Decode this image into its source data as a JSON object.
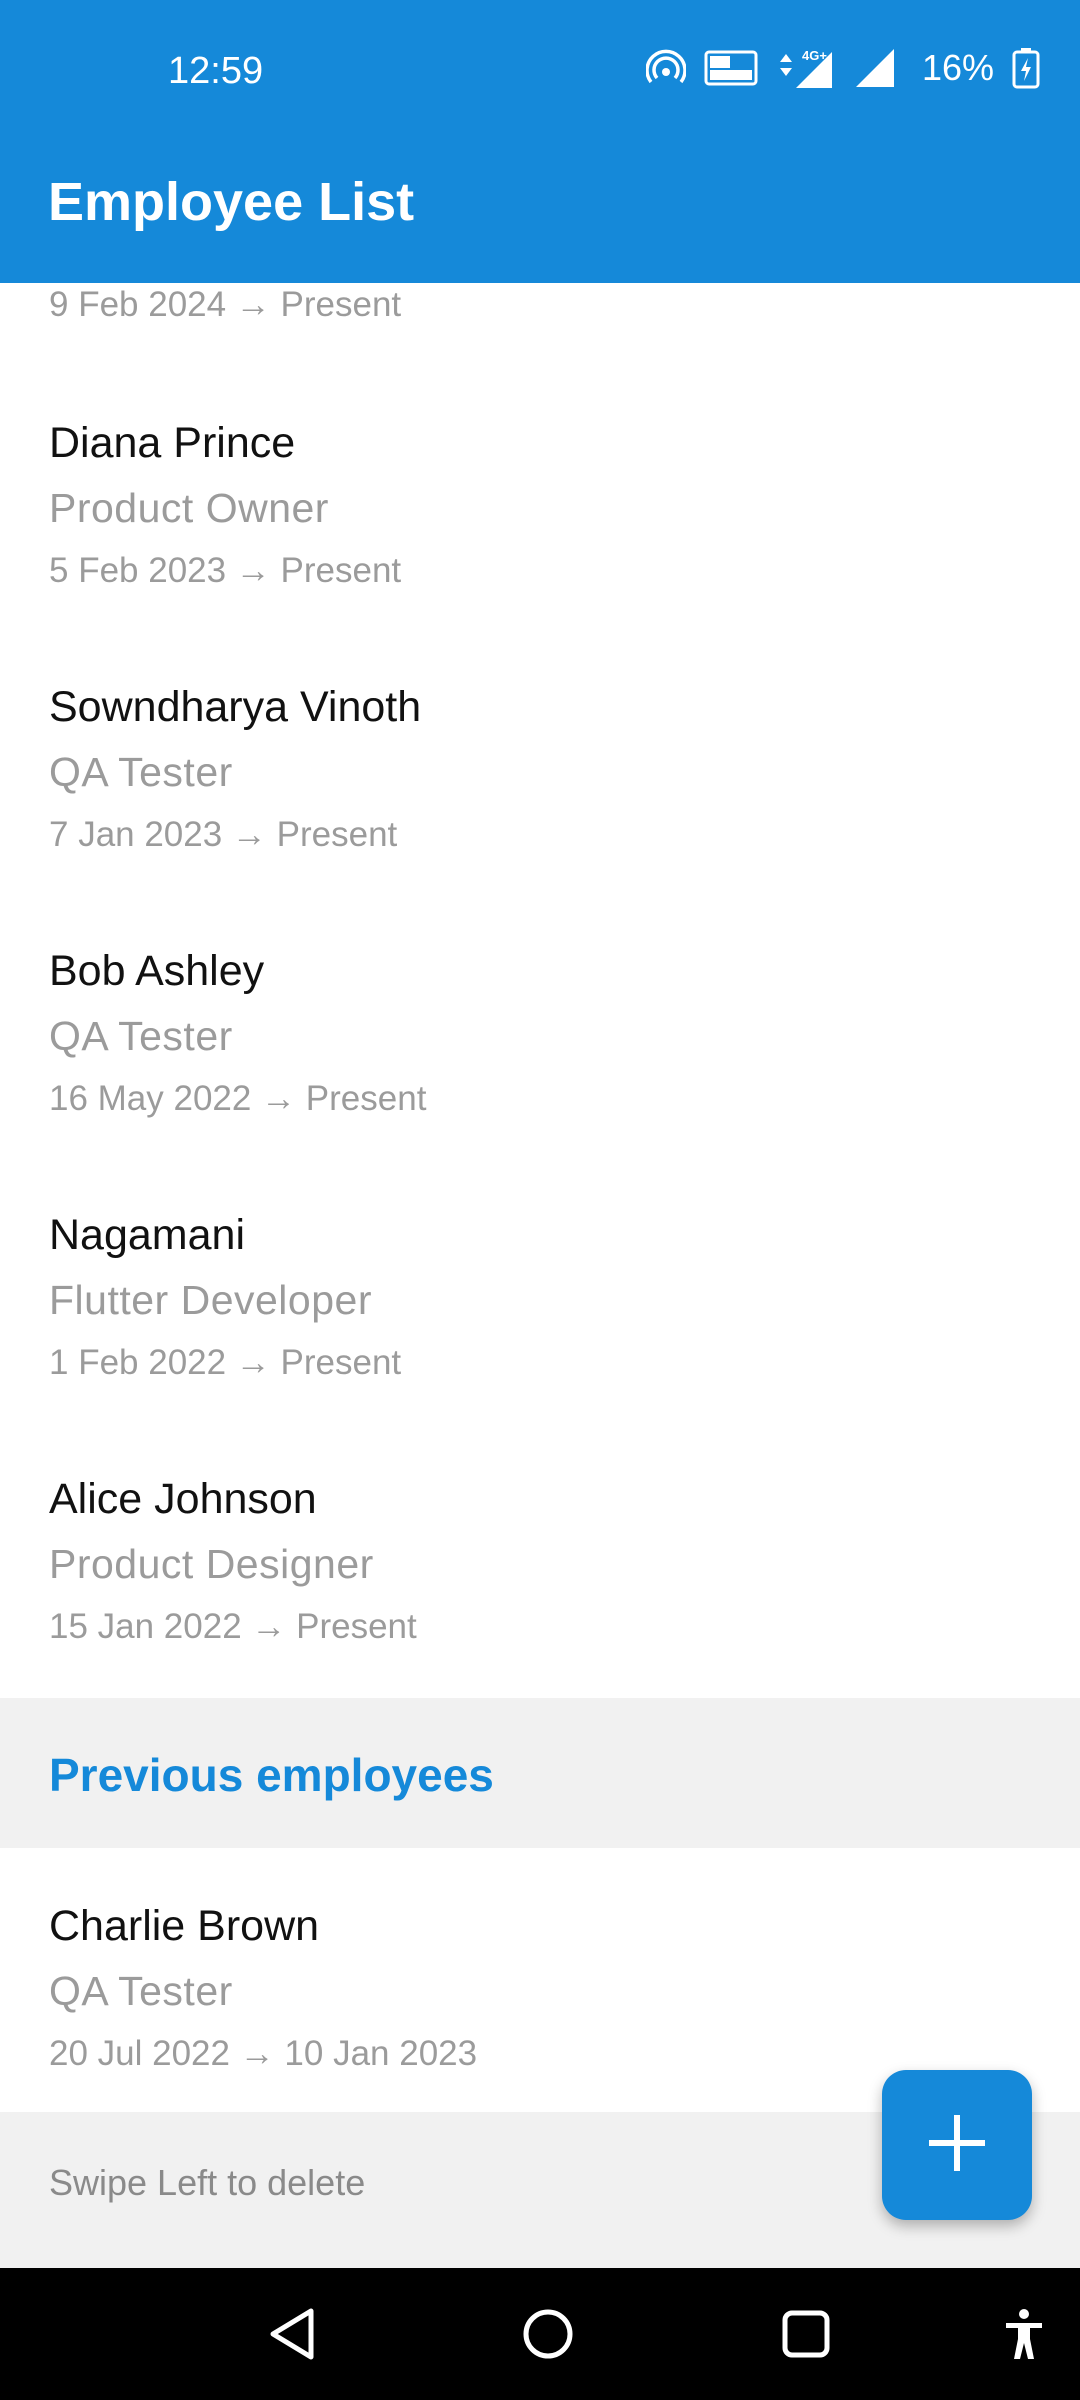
{
  "status_bar": {
    "time": "12:59",
    "battery_percent": "16%",
    "icons": [
      "hotspot-icon",
      "volte-icon",
      "4g-signal-icon",
      "signal-icon",
      "battery-icon"
    ]
  },
  "app_bar": {
    "title": "Employee List"
  },
  "partial_item": {
    "dates": "9 Feb 2024 → Present"
  },
  "current_employees": [
    {
      "name": "Diana Prince",
      "role": "Product Owner",
      "dates": "5 Feb 2023 → Present"
    },
    {
      "name": "Sowndharya Vinoth",
      "role": "QA Tester",
      "dates": "7 Jan 2023 → Present"
    },
    {
      "name": "Bob Ashley",
      "role": "QA Tester",
      "dates": "16 May 2022 → Present"
    },
    {
      "name": "Nagamani",
      "role": "Flutter Developer",
      "dates": "1 Feb 2022 → Present"
    },
    {
      "name": "Alice Johnson",
      "role": "Product Designer",
      "dates": "15 Jan 2022 → Present"
    }
  ],
  "previous_section": {
    "label": "Previous employees"
  },
  "previous_employees": [
    {
      "name": "Charlie Brown",
      "role": "QA Tester",
      "dates": "20 Jul 2022 → 10 Jan 2023"
    }
  ],
  "footer": {
    "hint": "Swipe Left to delete"
  },
  "fab": {
    "icon": "add-icon"
  },
  "nav_bar": {
    "icons": [
      "back-icon",
      "home-icon",
      "recents-icon",
      "accessibility-icon"
    ]
  },
  "colors": {
    "primary": "#1589d9",
    "secondary_text": "#9b9b9b",
    "section_bg": "#f1f1f1"
  }
}
